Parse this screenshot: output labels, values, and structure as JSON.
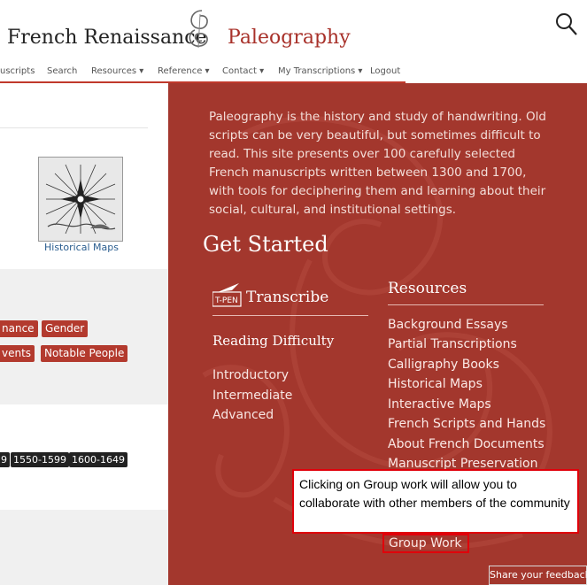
{
  "header": {
    "brand_left": "French Renaissance",
    "brand_right": "Paleography"
  },
  "nav": {
    "items": [
      {
        "label": "uscripts"
      },
      {
        "label": "Search"
      },
      {
        "label": "Resources ▾"
      },
      {
        "label": "Reference ▾"
      },
      {
        "label": "Contact ▾"
      },
      {
        "label": "My Transcriptions ▾"
      },
      {
        "label": "Logout"
      }
    ]
  },
  "left": {
    "map_caption": "Historical Maps",
    "tags": [
      "nance",
      "Gender",
      "vents",
      "Notable People"
    ],
    "dates": [
      "9",
      "1550-1599",
      "1600-1649"
    ]
  },
  "right": {
    "intro": "Paleography is the history and study of handwriting. Old scripts can be very beautiful, but sometimes difficult to read. This site presents over 100 carefully selected French manuscripts written between 1300 and 1700, with tools for deciphering them and learning about their social, cultural, and institutional settings.",
    "get_started": "Get Started",
    "transcribe": "Transcribe",
    "reading_difficulty": "Reading Difficulty",
    "levels": [
      "Introductory",
      "Intermediate",
      "Advanced"
    ],
    "resources_title": "Resources",
    "resources": [
      "Background Essays",
      "Partial Transcriptions",
      "Calligraphy Books",
      "Historical Maps",
      "Interactive Maps",
      "French Scripts and Hands",
      "About French Documents",
      "Manuscript Preservation"
    ],
    "group_work": "Group Work"
  },
  "callout": "Clicking on Group work will allow you to collaborate with other members of the community",
  "feedback": "Share your feedback",
  "colors": {
    "accent": "#a3372d",
    "tag": "#b33a2e",
    "highlight": "#e0000a"
  },
  "icons": {
    "search": "search-icon",
    "logo": "monogram-logo-icon",
    "tpen": "tpen-logo-icon"
  }
}
